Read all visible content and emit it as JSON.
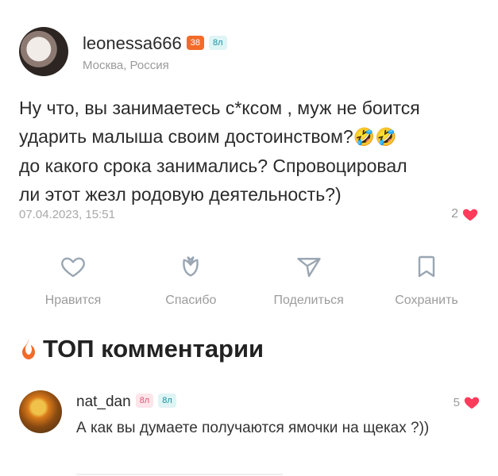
{
  "post": {
    "username": "leonessa666",
    "badge1": "38",
    "badge2": "8л",
    "location": "Москва, Россия",
    "text_line1": "Ну что, вы занимаетесь с*ксом , муж не боится",
    "text_line2": "ударить малыша своим достоинством?",
    "emoji": "🤣🤣",
    "text_line3": "до какого срока занимались? Спровоцировал",
    "text_line4": "ли этот жезл родовую деятельность?)",
    "date": "07.04.2023, 15:51",
    "likes": "2"
  },
  "actions": [
    {
      "label": "Нравится",
      "icon": "heart-outline-icon"
    },
    {
      "label": "Спасибо",
      "icon": "tulip-icon"
    },
    {
      "label": "Поделиться",
      "icon": "send-icon"
    },
    {
      "label": "Сохранить",
      "icon": "bookmark-icon"
    }
  ],
  "top": {
    "title": "ТОП комментарии"
  },
  "comment": {
    "username": "nat_dan",
    "badge1": "8л",
    "badge2": "8л",
    "text": "А как вы думаете получаются ямочки на щеках ?))",
    "likes": "5"
  },
  "colors": {
    "accent_red": "#ff3b5c",
    "fire": "#f26b2a",
    "muted": "#9c9c9c"
  }
}
